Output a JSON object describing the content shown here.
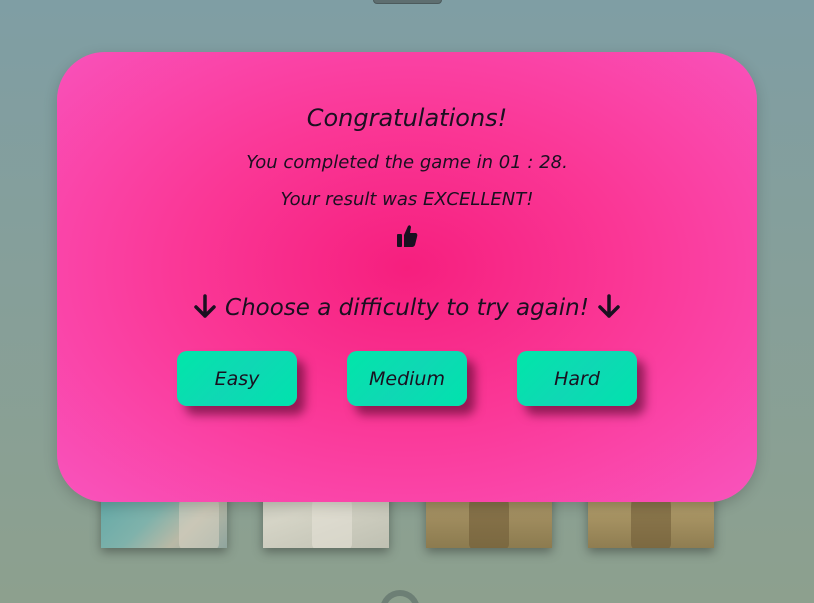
{
  "modal": {
    "title": "Congratulations!",
    "completed_text": "You completed the game in 01 : 28.",
    "result_text": "Your result was EXCELLENT!",
    "result_icon": "thumbs-up-icon",
    "prompt_text": "Choose a difficulty to try again!",
    "prompt_icon": "arrow-down-icon"
  },
  "difficulty_buttons": [
    {
      "label": "Easy"
    },
    {
      "label": "Medium"
    },
    {
      "label": "Hard"
    }
  ],
  "background_cards": [
    {
      "icon": "animal-photo-card"
    },
    {
      "icon": "animal-photo-card"
    },
    {
      "icon": "tiger-photo-card"
    },
    {
      "icon": "tiger-photo-card"
    }
  ],
  "colors": {
    "modal_center": "#f61f7e",
    "modal_edge": "#f954bd",
    "button": "#00e3ad",
    "backdrop": "#7f9ea4",
    "text": "#1a1020"
  }
}
